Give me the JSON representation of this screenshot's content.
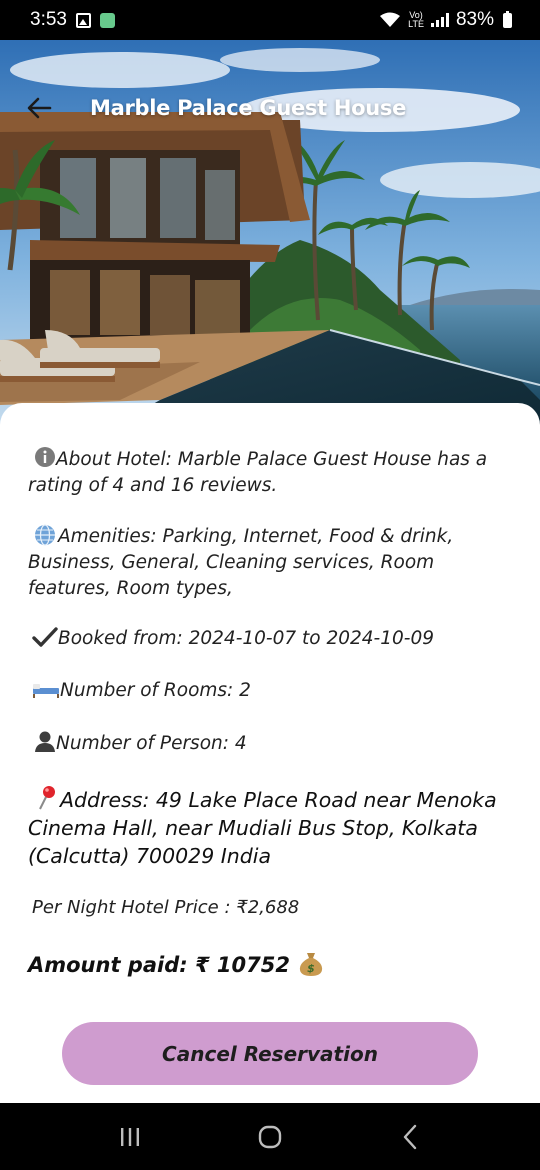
{
  "status_bar": {
    "time": "3:53",
    "lte_label": "Vo)\nLTE",
    "battery": "83%"
  },
  "header": {
    "title": "Marble Palace Guest House"
  },
  "details": {
    "about": "About Hotel: Marble Palace Guest House has a rating of 4 and 16 reviews.",
    "amenities": "Amenities: Parking, Internet, Food & drink, Business, General, Cleaning services, Room features, Room types,",
    "booked": "Booked from: 2024-10-07 to 2024-10-09",
    "rooms": "Number of Rooms: 2",
    "persons": "Number of Person: 4",
    "address": "Address: 49 Lake Place Road near Menoka Cinema Hall, near Mudiali Bus Stop, Kolkata (Calcutta) 700029 India",
    "price": "Per Night Hotel Price : ₹2,688",
    "amount_paid": "Amount paid: ₹ 10752"
  },
  "actions": {
    "cancel_label": "Cancel Reservation"
  },
  "icons": {
    "info": "info-icon",
    "globe": "globe-icon",
    "check": "checkmark-icon",
    "bed": "bed-icon",
    "person": "person-icon",
    "pin": "pin-icon",
    "money": "money-bag-icon"
  },
  "colors": {
    "button": "#cf9ccf",
    "status_bar": "#000000"
  }
}
